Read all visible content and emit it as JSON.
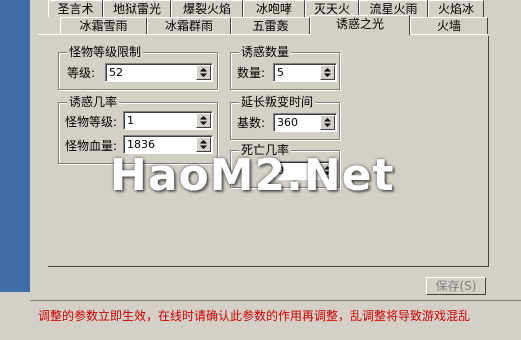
{
  "tabs_row1": [
    {
      "label": "圣言术"
    },
    {
      "label": "地狱雷光"
    },
    {
      "label": "爆裂火焰"
    },
    {
      "label": "冰咆哮"
    },
    {
      "label": "灭天火"
    },
    {
      "label": "流星火雨"
    },
    {
      "label": "火焰冰"
    }
  ],
  "tabs_row2": [
    {
      "label": "冰霜雪雨"
    },
    {
      "label": "冰霜群雨"
    },
    {
      "label": "五雷轰"
    },
    {
      "label": "诱惑之光"
    },
    {
      "label": "火墙"
    }
  ],
  "groups": {
    "level_limit": {
      "title": "怪物等级限制",
      "level_label": "等级:",
      "level_value": "52"
    },
    "temptation_count": {
      "title": "诱惑数量",
      "count_label": "数量:",
      "count_value": "5"
    },
    "temptation_rate": {
      "title": "诱惑几率",
      "monster_level_label": "怪物等级:",
      "monster_level_value": "1",
      "monster_hp_label": "怪物血量:",
      "monster_hp_value": "1836"
    },
    "extend_betrayal": {
      "title": "延长叛变时间",
      "base_label": "基数:",
      "base_value": "360"
    },
    "death_rate": {
      "title": "死亡几率",
      "value": "0"
    }
  },
  "save_button": {
    "label": "保存(S)",
    "enabled": false
  },
  "hint_text": "调整的参数立即生效，在线时请确认此参数的作用再调整，乱调整将导致游戏混乱",
  "watermark": "HaoM2.Net",
  "colors": {
    "panel": "#d4d0c8",
    "hint": "#cc0000",
    "desktop": "#3d6ea5"
  }
}
